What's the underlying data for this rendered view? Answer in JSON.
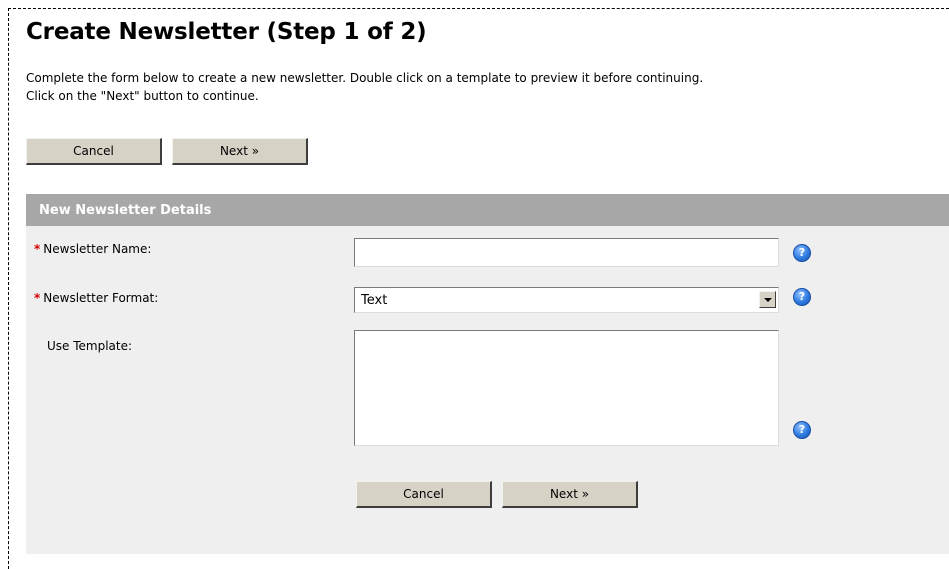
{
  "page": {
    "title": "Create Newsletter (Step 1 of 2)",
    "intro_line1": "Complete the form below to create a new newsletter. Double click on a template to preview it before continuing.",
    "intro_line2": "Click on the \"Next\" button to continue."
  },
  "top_buttons": {
    "cancel": "Cancel",
    "next": "Next »"
  },
  "panel": {
    "header": "New Newsletter Details"
  },
  "form": {
    "required_marker": "*",
    "name_label": "Newsletter Name:",
    "name_value": "",
    "format_label": "Newsletter Format:",
    "format_value": "Text",
    "template_label": "Use Template:",
    "template_items": []
  },
  "bottom_buttons": {
    "cancel": "Cancel",
    "next": "Next »"
  },
  "icons": {
    "help": "help-icon",
    "dropdown": "chevron-down-icon"
  },
  "colors": {
    "required": "#d40000",
    "panel_header": "#a7a7a7",
    "panel_body": "#efefef",
    "button_face": "#d7d2c6",
    "help_icon": "#2f7be0"
  }
}
